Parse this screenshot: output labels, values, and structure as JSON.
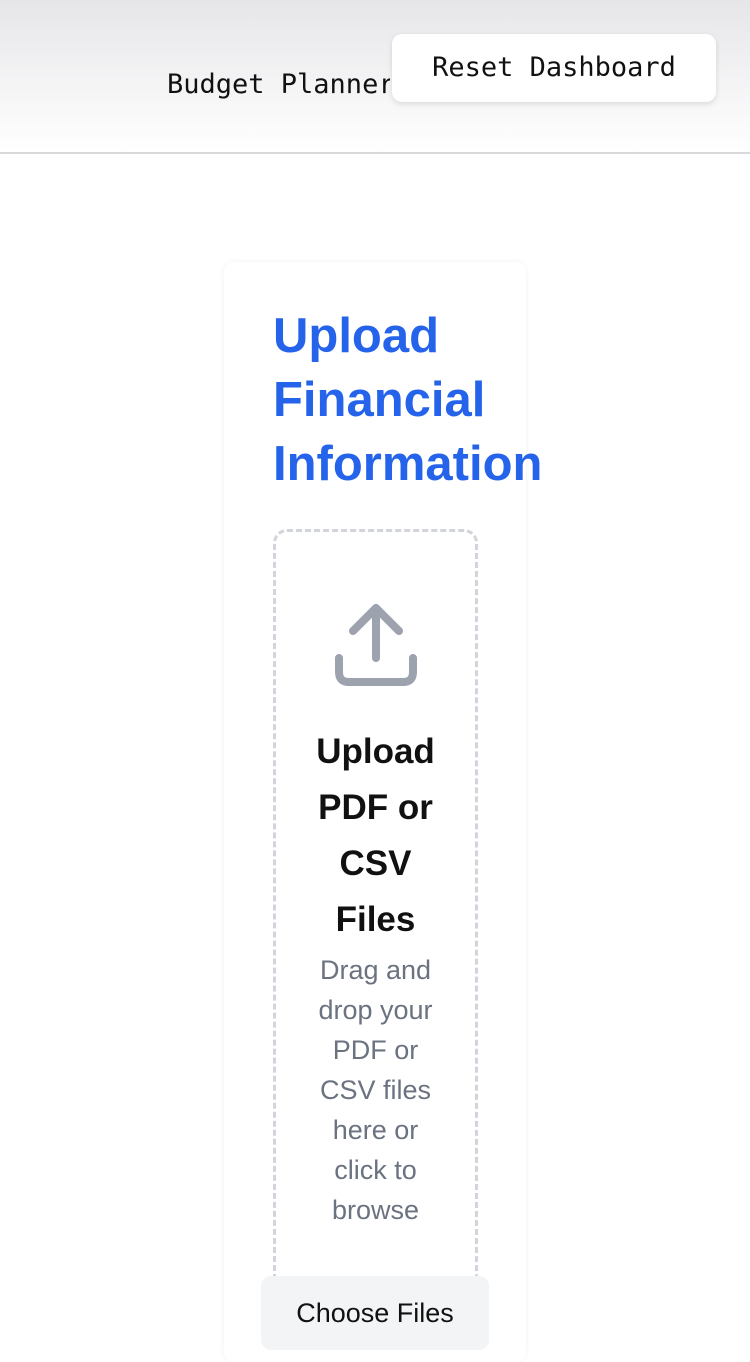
{
  "header": {
    "app_title": "Budget Planner",
    "reset_label": "Reset Dashboard"
  },
  "upload_card": {
    "title": "Upload\nFinancial\nInformation",
    "dropzone": {
      "icon": "upload-icon",
      "title": "Upload\nPDF or\nCSV\nFiles",
      "subtitle": "Drag and\ndrop your\nPDF or\nCSV files\nhere or\nclick to\nbrowse"
    },
    "choose_label": "Choose Files"
  },
  "colors": {
    "accent": "#2563eb",
    "muted_text": "#6b7280",
    "icon_gray": "#9ca3af",
    "dash_border": "#d1d5db"
  }
}
